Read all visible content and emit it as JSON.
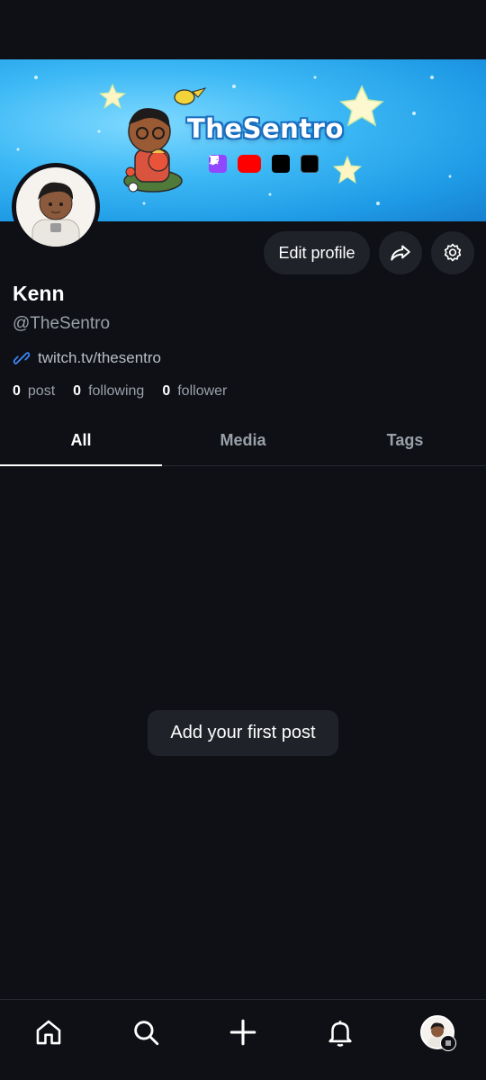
{
  "banner": {
    "title": "TheSentro",
    "socials": [
      "twitch-icon",
      "youtube-icon",
      "tiktok-icon",
      "x-icon"
    ]
  },
  "actions": {
    "edit_profile_label": "Edit profile",
    "share_icon": "share-icon",
    "settings_icon": "gear-icon"
  },
  "profile": {
    "name": "Kenn",
    "handle": "@TheSentro",
    "link": "twitch.tv/thesentro",
    "stats": [
      {
        "count": "0",
        "label": "post"
      },
      {
        "count": "0",
        "label": "following"
      },
      {
        "count": "0",
        "label": "follower"
      }
    ]
  },
  "tabs": [
    {
      "label": "All",
      "active": true
    },
    {
      "label": "Media",
      "active": false
    },
    {
      "label": "Tags",
      "active": false
    }
  ],
  "empty_state": {
    "label": "Add your first post"
  },
  "bottom_nav": [
    "home-icon",
    "search-icon",
    "plus-icon",
    "bell-icon",
    "avatar"
  ],
  "colors": {
    "background": "#0e1016",
    "surface": "#1f2229",
    "link": "#3d8bfd",
    "muted": "#9aa0a8"
  }
}
